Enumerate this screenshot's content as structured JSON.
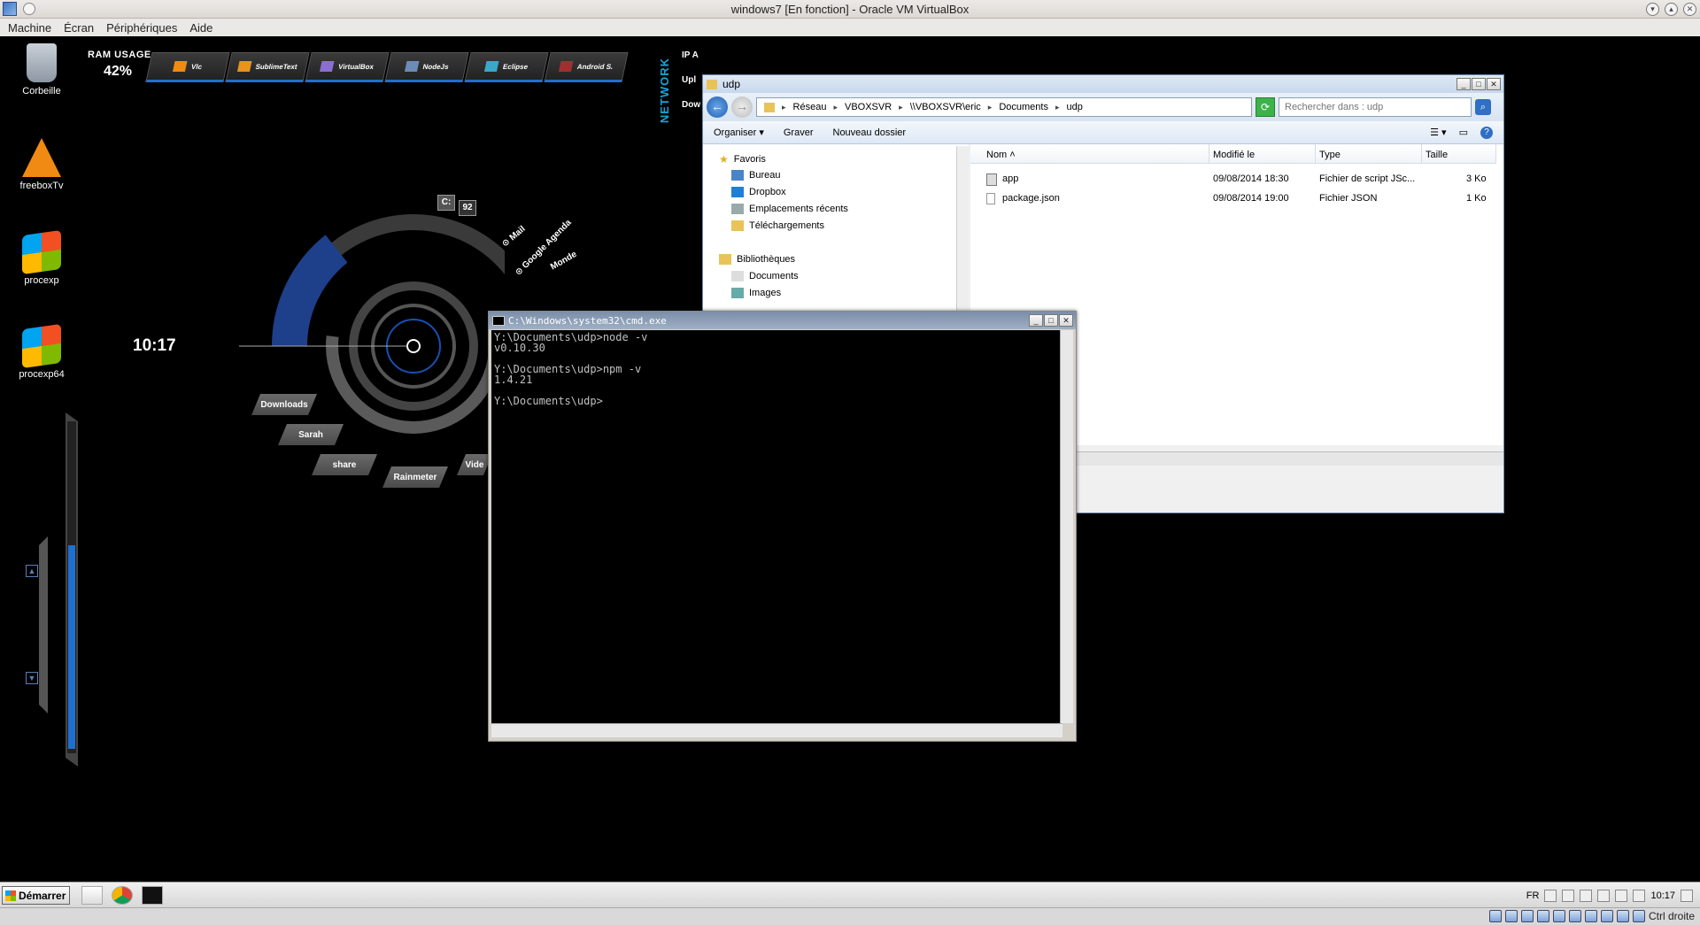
{
  "host": {
    "title": "windows7 [En fonction] - Oracle VM VirtualBox",
    "menu": [
      "Machine",
      "Écran",
      "Périphériques",
      "Aide"
    ],
    "host_key": "Ctrl droite"
  },
  "desktop": {
    "icons": [
      {
        "label": "Corbeille",
        "icon": "recycle-bin-icon"
      },
      {
        "label": "freeboxTv",
        "icon": "vlc-icon"
      },
      {
        "label": "procexp",
        "icon": "process-explorer-icon"
      },
      {
        "label": "procexp64",
        "icon": "process-explorer-icon"
      }
    ]
  },
  "rainmeter": {
    "ram_label": "RAM USAGE",
    "ram_value": "42%",
    "launchers": [
      "Vlc",
      "SublimeText",
      "VirtualBox",
      "NodeJs",
      "Eclipse",
      "Android S."
    ],
    "network_label": "NETWORK",
    "network_lines": [
      "IP A",
      "Upl",
      "Dow"
    ],
    "clock": "10:17",
    "drive_label": "C:",
    "drive_value": "92",
    "radial_links": [
      "Mail",
      "Google Agenda",
      "Monde"
    ],
    "shortcuts": [
      "Downloads",
      "Sarah",
      "share",
      "Rainmeter",
      "Vide"
    ]
  },
  "explorer": {
    "title": "udp",
    "breadcrumb": [
      "Réseau",
      "VBOXSVR",
      "\\\\VBOXSVR\\eric",
      "Documents",
      "udp"
    ],
    "search_placeholder": "Rechercher dans : udp",
    "commands": [
      "Organiser",
      "Graver",
      "Nouveau dossier"
    ],
    "nav": {
      "favorites_header": "Favoris",
      "favorites": [
        "Bureau",
        "Dropbox",
        "Emplacements récents",
        "Téléchargements"
      ],
      "libraries_header": "Bibliothèques",
      "libraries": [
        "Documents",
        "Images"
      ]
    },
    "columns": [
      "Nom",
      "Modifié le",
      "Type",
      "Taille"
    ],
    "files": [
      {
        "name": "app",
        "modified": "09/08/2014 18:30",
        "type": "Fichier de script JSc...",
        "size": "3 Ko"
      },
      {
        "name": "package.json",
        "modified": "09/08/2014 19:00",
        "type": "Fichier JSON",
        "size": "1 Ko"
      }
    ]
  },
  "cmd": {
    "title": "C:\\Windows\\system32\\cmd.exe",
    "output": "Y:\\Documents\\udp>node -v\nv0.10.30\n\nY:\\Documents\\udp>npm -v\n1.4.21\n\nY:\\Documents\\udp>"
  },
  "taskbar": {
    "start_label": "Démarrer",
    "language": "FR",
    "time": "10:17"
  }
}
